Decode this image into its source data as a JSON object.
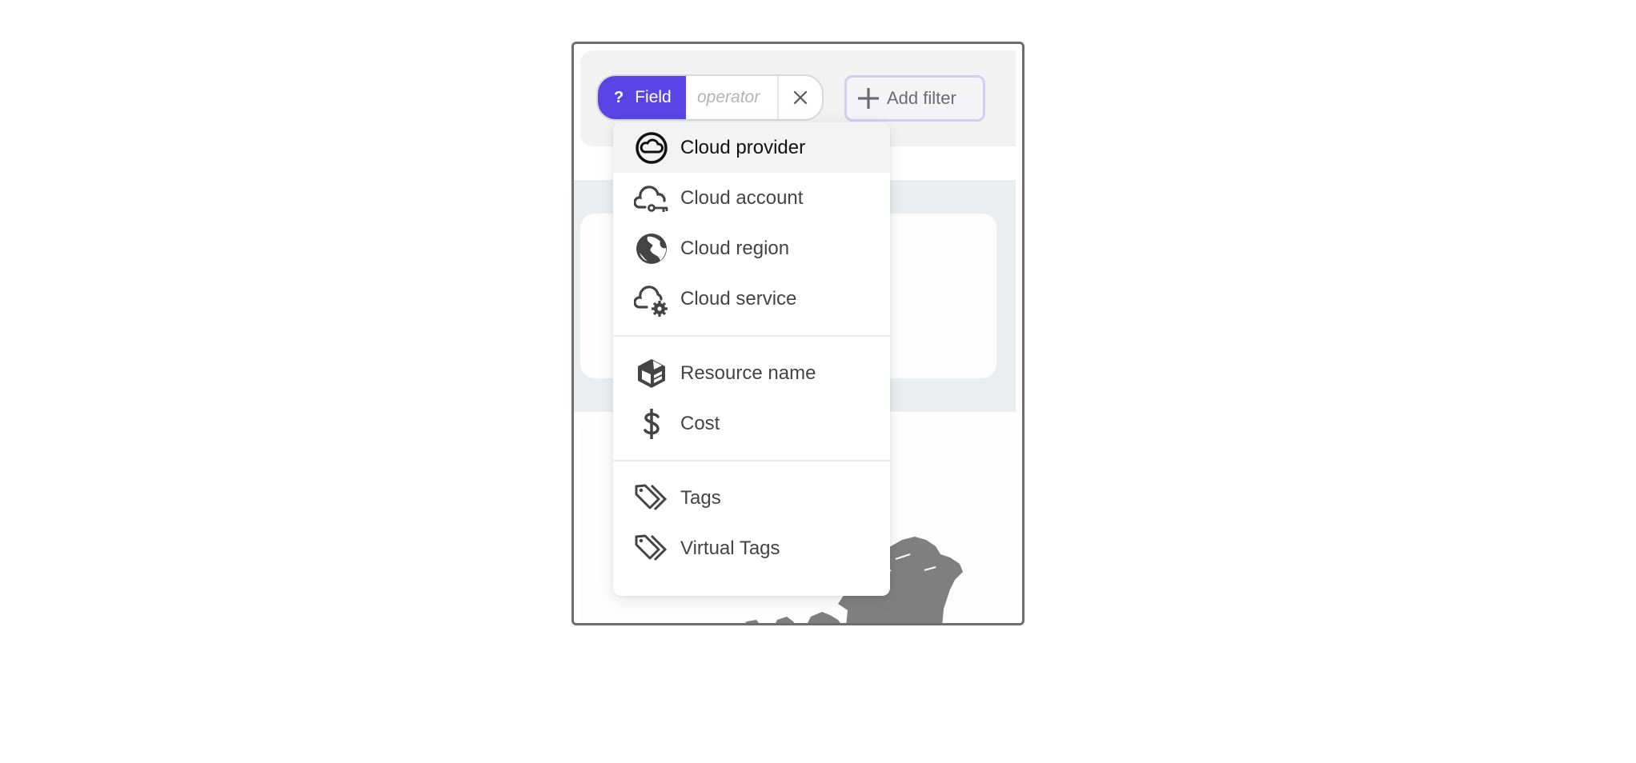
{
  "filter_chip": {
    "field_icon": "question-mark",
    "field_label": "Field",
    "operator_placeholder": "operator",
    "remove_icon": "close-icon"
  },
  "add_filter": {
    "icon": "plus-icon",
    "label": "Add filter"
  },
  "colors": {
    "accent": "#5a44e6",
    "add_filter_border": "#d3ccf5",
    "menu_text": "#444444",
    "active_text": "#111111",
    "map_fill": "#7f7f7f"
  },
  "field_menu": {
    "groups": [
      {
        "items": [
          {
            "label": "Cloud provider",
            "icon": "cloud-circle-icon",
            "active": true
          },
          {
            "label": "Cloud account",
            "icon": "cloud-key-icon",
            "active": false
          },
          {
            "label": "Cloud region",
            "icon": "globe-icon",
            "active": false
          },
          {
            "label": "Cloud service",
            "icon": "cloud-gear-icon",
            "active": false
          }
        ]
      },
      {
        "items": [
          {
            "label": "Resource name",
            "icon": "box-icon",
            "active": false
          },
          {
            "label": "Cost",
            "icon": "dollar-icon",
            "active": false
          }
        ]
      },
      {
        "items": [
          {
            "label": "Tags",
            "icon": "tags-icon",
            "active": false
          },
          {
            "label": "Virtual Tags",
            "icon": "tags-icon",
            "active": false
          }
        ]
      }
    ]
  }
}
